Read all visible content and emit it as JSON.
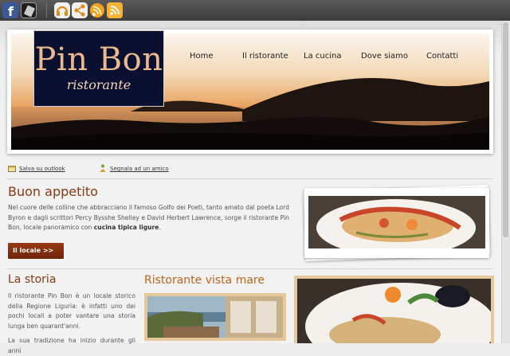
{
  "toolbar": {
    "icons": [
      "facebook-icon",
      "mobile-icon",
      "headphones-icon",
      "share-icon",
      "rss-circle-icon",
      "rss-icon"
    ]
  },
  "logo": {
    "title": "Pin Bon",
    "subtitle": "ristorante"
  },
  "nav": {
    "items": [
      "Home",
      "Il ristorante",
      "La cucina",
      "Dove siamo",
      "Contatti"
    ]
  },
  "links": {
    "save_outlook": "Salva su outlook",
    "recommend": "Segnala ad un amico"
  },
  "intro": {
    "title": "Buon appetito",
    "text_before": "Nel cuore delle colline che abbracciano il famoso Golfo dei Poeti, tanto amato dal poeta Lord Byron e dagli scrittori Percy Bysshe Shelley e David Herbert Lawrence, sorge il ristorante Pin Bon, locale panoramico con ",
    "text_bold": "cucina tipica ligure",
    "text_after": ".",
    "button": "Il locale >>"
  },
  "storia": {
    "title": "La storia",
    "p1": "Il ristorante Pin Bon è un locale storico della Regione Liguria: è infatti uno dei pochi locali a poter vantare una storia lunga ben quarant'anni.",
    "p2": "La sua tradizione ha inizio durante gli anni"
  },
  "vista": {
    "title": "Ristorante vista mare"
  },
  "colors": {
    "accent": "#8a3a12",
    "heading_orange": "#b9651b",
    "photo_frame": "#e7c79c"
  }
}
